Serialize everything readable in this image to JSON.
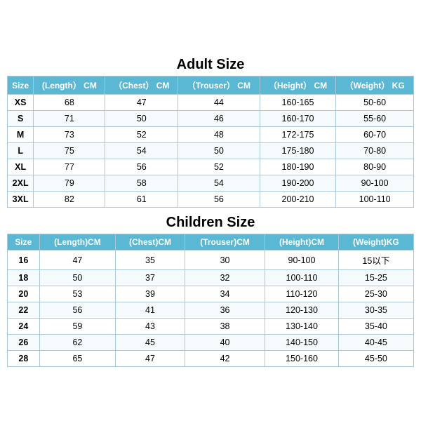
{
  "adult": {
    "title": "Adult Size",
    "headers": [
      "Size",
      "(Length） CM",
      "（Chest） CM",
      "（Trouser） CM",
      "（Height） CM",
      "（Weight） KG"
    ],
    "rows": [
      [
        "XS",
        "68",
        "47",
        "44",
        "160-165",
        "50-60"
      ],
      [
        "S",
        "71",
        "50",
        "46",
        "160-170",
        "55-60"
      ],
      [
        "M",
        "73",
        "52",
        "48",
        "172-175",
        "60-70"
      ],
      [
        "L",
        "75",
        "54",
        "50",
        "175-180",
        "70-80"
      ],
      [
        "XL",
        "77",
        "56",
        "52",
        "180-190",
        "80-90"
      ],
      [
        "2XL",
        "79",
        "58",
        "54",
        "190-200",
        "90-100"
      ],
      [
        "3XL",
        "82",
        "61",
        "56",
        "200-210",
        "100-110"
      ]
    ]
  },
  "children": {
    "title": "Children Size",
    "headers": [
      "Size",
      "(Length)CM",
      "(Chest)CM",
      "(Trouser)CM",
      "(Height)CM",
      "(Weight)KG"
    ],
    "rows": [
      [
        "16",
        "47",
        "35",
        "30",
        "90-100",
        "15以下"
      ],
      [
        "18",
        "50",
        "37",
        "32",
        "100-110",
        "15-25"
      ],
      [
        "20",
        "53",
        "39",
        "34",
        "110-120",
        "25-30"
      ],
      [
        "22",
        "56",
        "41",
        "36",
        "120-130",
        "30-35"
      ],
      [
        "24",
        "59",
        "43",
        "38",
        "130-140",
        "35-40"
      ],
      [
        "26",
        "62",
        "45",
        "40",
        "140-150",
        "40-45"
      ],
      [
        "28",
        "65",
        "47",
        "42",
        "150-160",
        "45-50"
      ]
    ]
  }
}
